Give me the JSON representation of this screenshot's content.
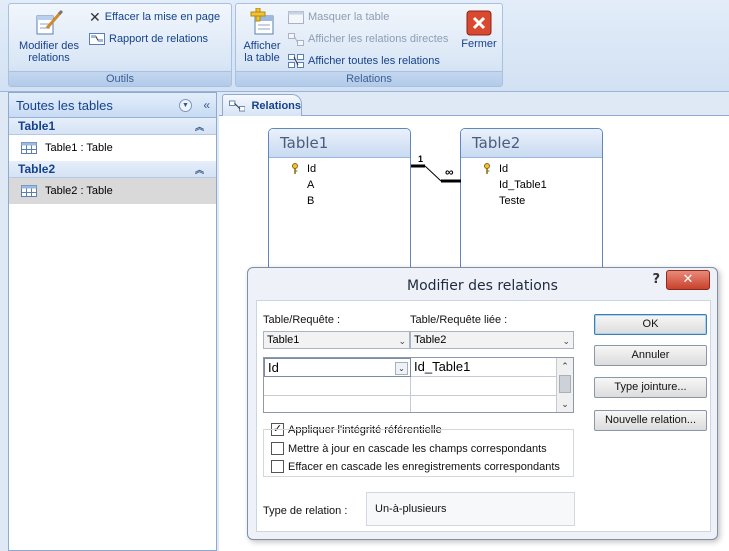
{
  "ribbon": {
    "tools_group": {
      "title": "Outils",
      "edit_relations": "Modifier des relations",
      "clear_layout": "Effacer la mise en page",
      "relations_report": "Rapport de relations"
    },
    "relations_group": {
      "title": "Relations",
      "show_table": "Afficher la table",
      "hide_table": "Masquer la table",
      "show_direct": "Afficher les relations directes",
      "show_all": "Afficher toutes les relations",
      "close": "Fermer"
    }
  },
  "nav": {
    "header": "Toutes les tables",
    "groups": [
      {
        "name": "Table1",
        "items": [
          {
            "label": "Table1 : Table"
          }
        ]
      },
      {
        "name": "Table2",
        "items": [
          {
            "label": "Table2 : Table"
          }
        ]
      }
    ]
  },
  "document": {
    "tab_label": "Relations",
    "tables": [
      {
        "name": "Table1",
        "fields": [
          "Id",
          "A",
          "B"
        ]
      },
      {
        "name": "Table2",
        "fields": [
          "Id",
          "Id_Table1",
          "Teste"
        ]
      }
    ],
    "join_one": "1",
    "join_many": "∞"
  },
  "dialog": {
    "title": "Modifier des relations",
    "help": "?",
    "close": "✕",
    "table_label": "Table/Requête :",
    "related_label": "Table/Requête liée :",
    "table_value": "Table1",
    "related_value": "Table2",
    "field_left": "Id",
    "field_right": "Id_Table1",
    "enforce_integrity": "Appliquer l'intégrité référentielle",
    "cascade_update": "Mettre à jour en cascade les champs correspondants",
    "cascade_delete": "Effacer en cascade les enregistrements correspondants",
    "relation_type_label": "Type de relation :",
    "relation_type_value": "Un-à-plusieurs",
    "ok": "OK",
    "cancel": "Annuler",
    "join_type": "Type jointure...",
    "new_relation": "Nouvelle relation...",
    "enforce_checked": true,
    "cascade_update_checked": false,
    "cascade_delete_checked": false
  }
}
